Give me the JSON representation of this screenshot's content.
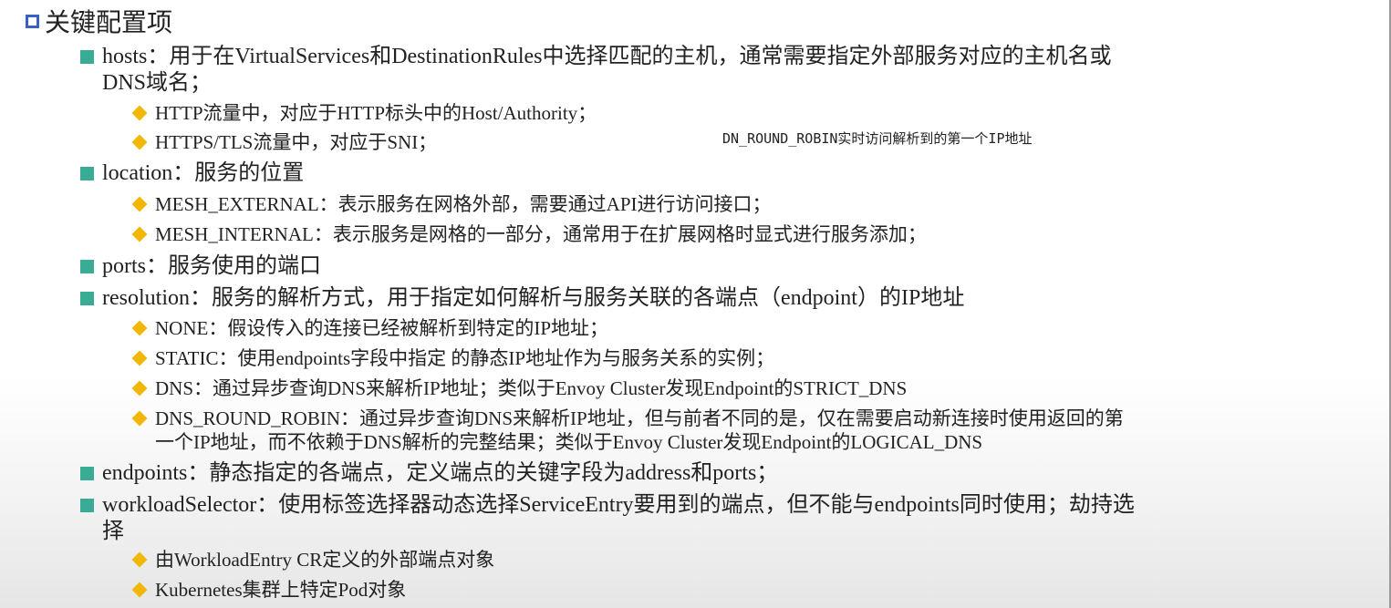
{
  "title": "关键配置项",
  "note": "DN_ROUND_ROBIN实时访问解析到的第一个IP地址",
  "items": [
    {
      "level": 1,
      "lines": [
        "hosts：用于在VirtualServices和DestinationRules中选择匹配的主机，通常需要指定外部服务对应的主机名或",
        "DNS域名；"
      ]
    },
    {
      "level": 2,
      "lines": [
        "HTTP流量中，对应于HTTP标头中的Host/Authority；"
      ]
    },
    {
      "level": 2,
      "lines": [
        "HTTPS/TLS流量中，对应于SNI；"
      ]
    },
    {
      "level": 1,
      "lines": [
        "location：服务的位置"
      ]
    },
    {
      "level": 2,
      "lines": [
        "MESH_EXTERNAL：表示服务在网格外部，需要通过API进行访问接口；"
      ]
    },
    {
      "level": 2,
      "lines": [
        "MESH_INTERNAL：表示服务是网格的一部分，通常用于在扩展网格时显式进行服务添加；"
      ]
    },
    {
      "level": 1,
      "lines": [
        "ports：服务使用的端口"
      ]
    },
    {
      "level": 1,
      "lines": [
        "resolution：服务的解析方式，用于指定如何解析与服务关联的各端点（endpoint）的IP地址"
      ]
    },
    {
      "level": 2,
      "lines": [
        "NONE：假设传入的连接已经被解析到特定的IP地址；"
      ]
    },
    {
      "level": 2,
      "lines": [
        "STATIC：使用endpoints字段中指定 的静态IP地址作为与服务关系的实例；"
      ]
    },
    {
      "level": 2,
      "lines": [
        "DNS：通过异步查询DNS来解析IP地址；类似于Envoy Cluster发现Endpoint的STRICT_DNS"
      ]
    },
    {
      "level": 2,
      "lines": [
        "DNS_ROUND_ROBIN：通过异步查询DNS来解析IP地址，但与前者不同的是，仅在需要启动新连接时使用返回的第",
        "一个IP地址，而不依赖于DNS解析的完整结果；类似于Envoy Cluster发现Endpoint的LOGICAL_DNS"
      ]
    },
    {
      "level": 1,
      "lines": [
        "endpoints：静态指定的各端点，定义端点的关键字段为address和ports；"
      ]
    },
    {
      "level": 1,
      "lines": [
        "workloadSelector：使用标签选择器动态选择ServiceEntry要用到的端点，但不能与endpoints同时使用；劫持选",
        "择"
      ]
    },
    {
      "level": 2,
      "lines": [
        "由WorkloadEntry CR定义的外部端点对象"
      ]
    },
    {
      "level": 2,
      "lines": [
        "Kubernetes集群上特定Pod对象"
      ]
    }
  ]
}
